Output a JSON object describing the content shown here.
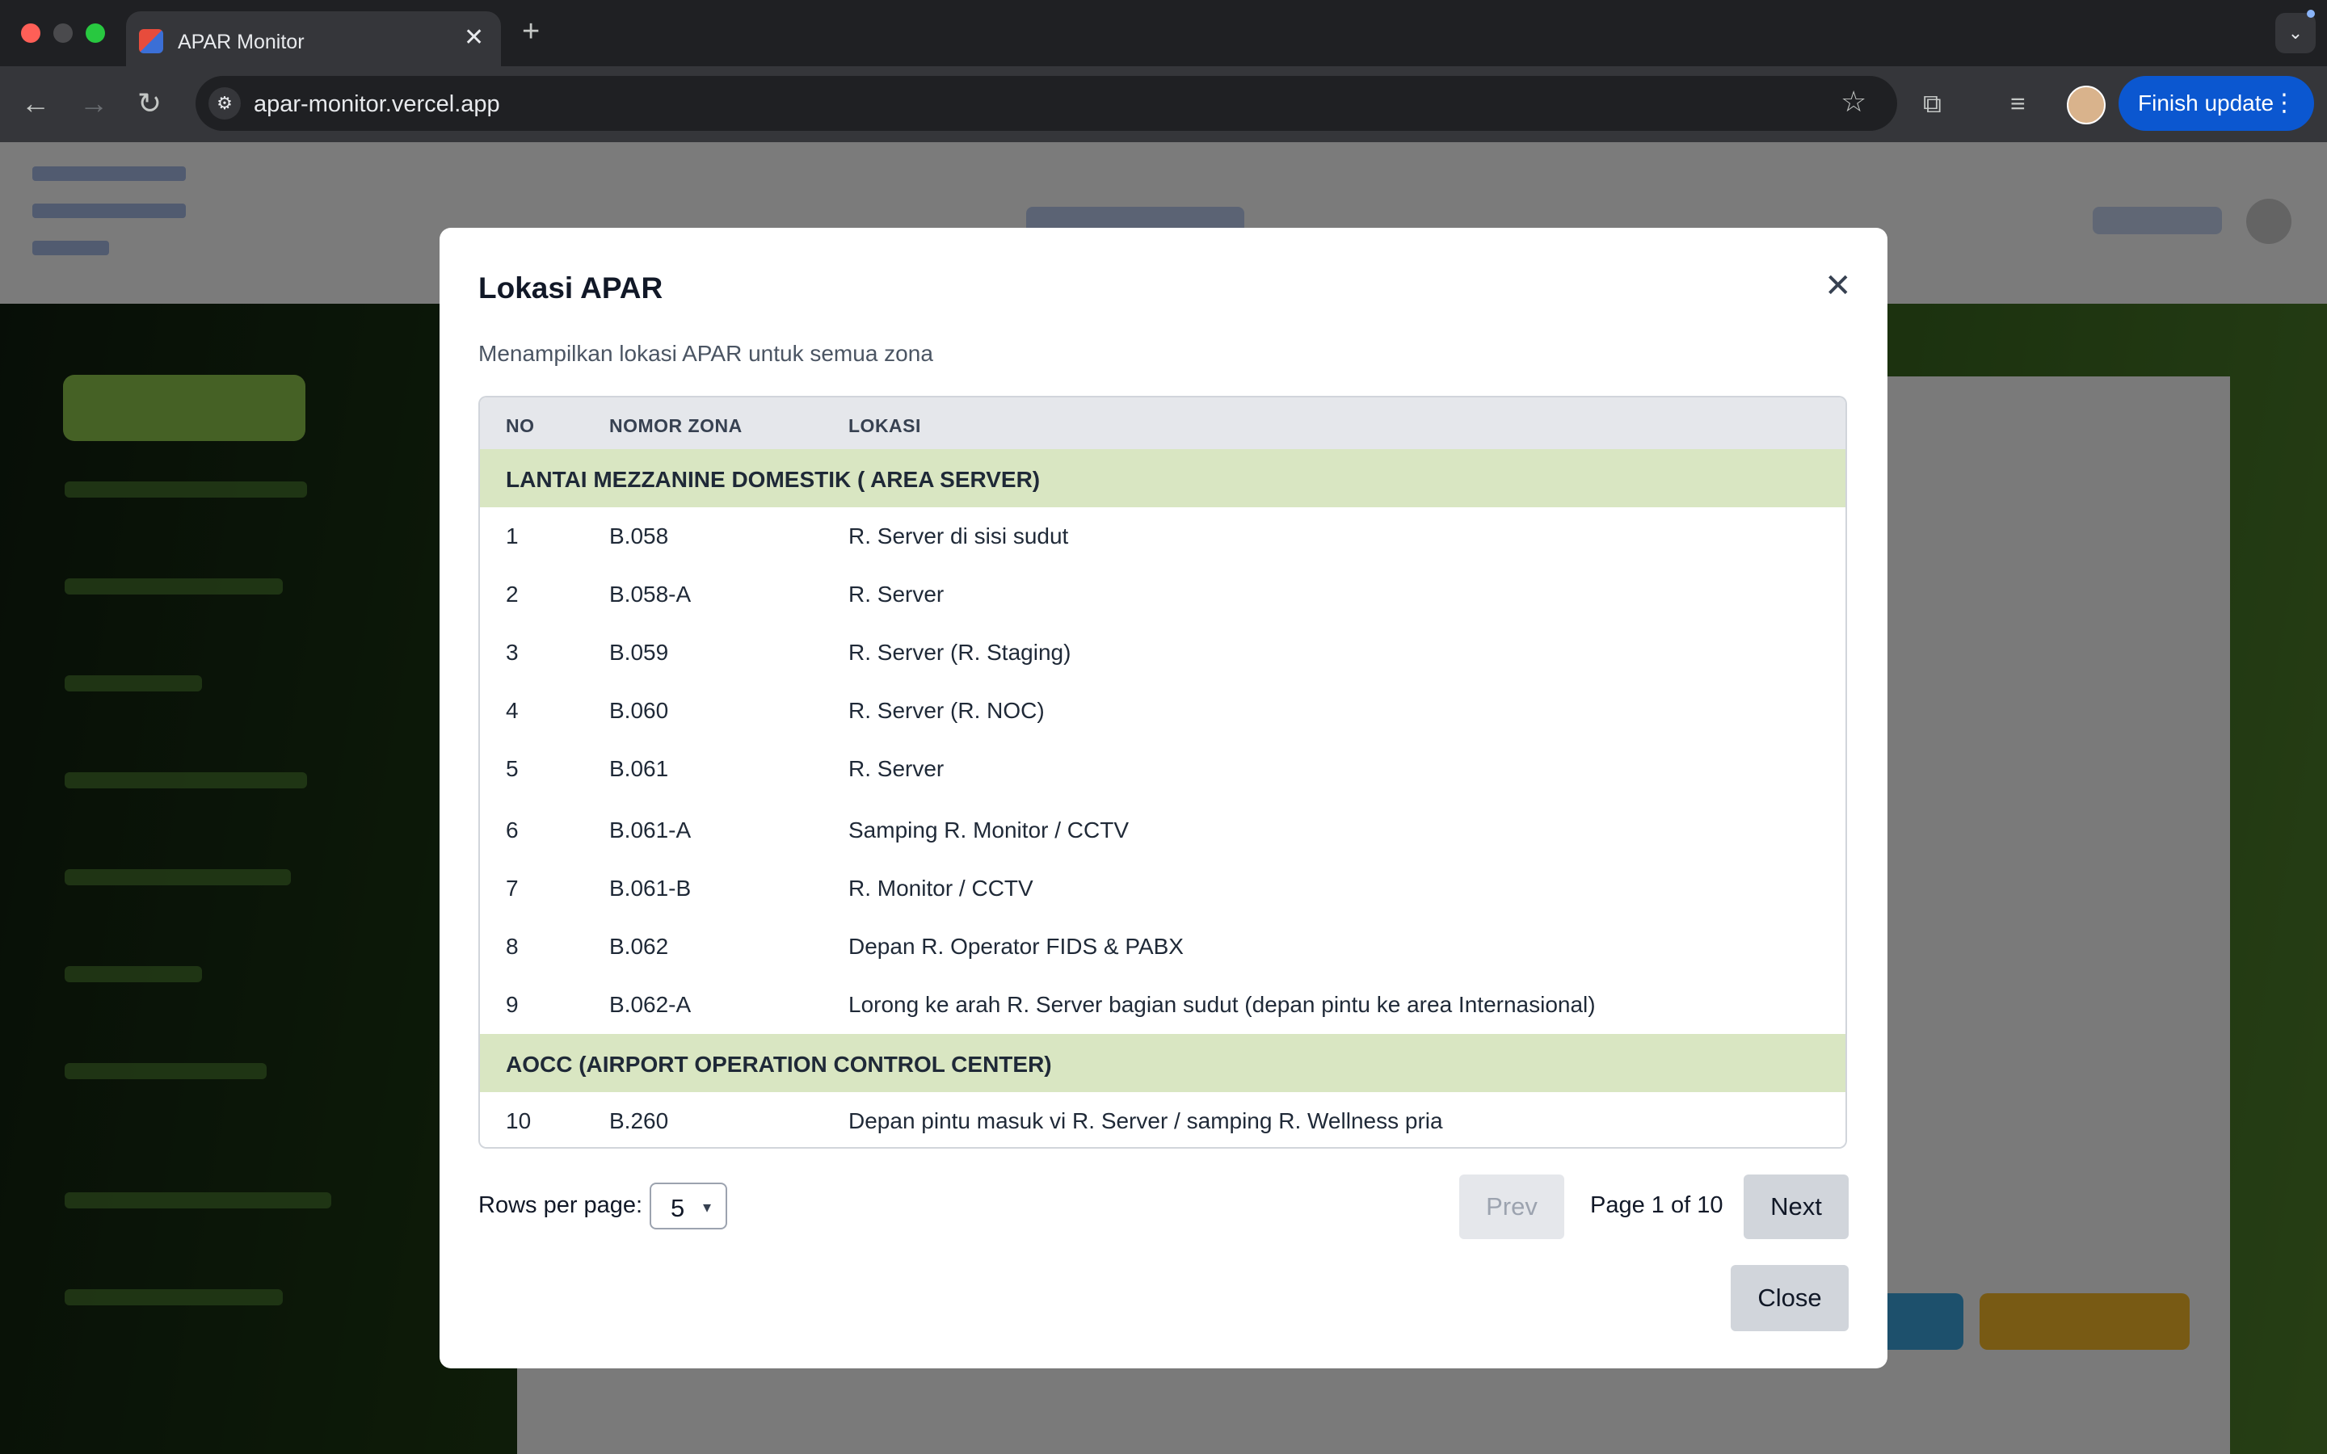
{
  "browser": {
    "tab_title": "APAR Monitor",
    "url": "apar-monitor.vercel.app",
    "finish_update_label": "Finish update"
  },
  "modal": {
    "title": "Lokasi APAR",
    "subtitle": "Menampilkan lokasi APAR untuk semua zona",
    "columns": [
      "NO",
      "NOMOR ZONA",
      "LOKASI"
    ],
    "groups": [
      {
        "name": "LANTAI MEZZANINE DOMESTIK ( AREA SERVER)",
        "rows": [
          {
            "no": "1",
            "zona": "B.058",
            "lokasi": "R. Server di sisi sudut"
          },
          {
            "no": "2",
            "zona": "B.058-A",
            "lokasi": "R. Server"
          },
          {
            "no": "3",
            "zona": "B.059",
            "lokasi": "R. Server (R. Staging)"
          },
          {
            "no": "4",
            "zona": "B.060",
            "lokasi": "R. Server (R. NOC)"
          },
          {
            "no": "5",
            "zona": "B.061",
            "lokasi": "R. Server"
          },
          {
            "no": "6",
            "zona": "B.061-A",
            "lokasi": "Samping R. Monitor / CCTV"
          },
          {
            "no": "7",
            "zona": "B.061-B",
            "lokasi": "R. Monitor / CCTV"
          },
          {
            "no": "8",
            "zona": "B.062",
            "lokasi": "Depan R. Operator FIDS & PABX"
          },
          {
            "no": "9",
            "zona": "B.062-A",
            "lokasi": "Lorong ke arah R. Server bagian sudut (depan pintu ke area Internasional)"
          }
        ]
      },
      {
        "name": "AOCC (AIRPORT OPERATION CONTROL CENTER)",
        "rows": [
          {
            "no": "10",
            "zona": "B.260",
            "lokasi": "Depan pintu masuk vi R. Server / samping R. Wellness pria"
          }
        ]
      }
    ],
    "pagination": {
      "rows_per_page_label": "Rows per page:",
      "rows_per_page_value": "5",
      "prev_label": "Prev",
      "page_info": "Page 1 of 10",
      "next_label": "Next"
    },
    "close_label": "Close"
  },
  "icons": {
    "close": "close-icon",
    "star": "star-icon",
    "caret": "chevron-down-icon"
  },
  "colors": {
    "group_row_bg": "#d9e6c2",
    "header_row_bg": "#e5e7eb",
    "finish_update_bg": "#0b57d0"
  }
}
